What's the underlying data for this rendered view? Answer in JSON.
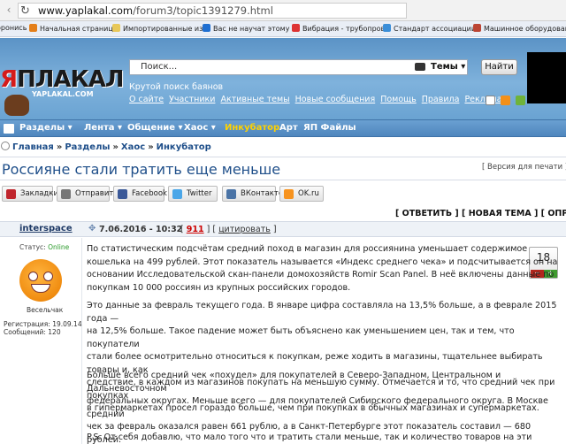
{
  "browser": {
    "url_host": "www.yaplakal.com",
    "url_path": "/forum3/topic1391279.html",
    "bookmarks": [
      {
        "label": "оронись",
        "color": "#c33"
      },
      {
        "label": "Начальная страница",
        "color": "#e47f1a"
      },
      {
        "label": "Импортированные из F",
        "color": "#e8c85a"
      },
      {
        "label": "Вас не научат этому в",
        "color": "#1f6fd1"
      },
      {
        "label": "Вибрация - трубопров",
        "color": "#d33"
      },
      {
        "label": "Стандарт ассоциации",
        "color": "#3a8ed8"
      },
      {
        "label": "Машинное оборудован",
        "color": "#b43"
      }
    ]
  },
  "site": {
    "logo_text": "ЯПЛАКАЛ",
    "logo_domain": "YAPLAKAL.COM",
    "search_placeholder": "Поиск...",
    "search_scope": "Темы ▾",
    "find_button": "Найти",
    "tagline": "Крутой поиск баянов",
    "header_links": [
      "О сайте",
      "Участники",
      "Активные темы",
      "Новые сообщения",
      "Помощь",
      "Правила",
      "Реклама"
    ]
  },
  "menu": {
    "items": [
      {
        "label": "Разделы ▾"
      },
      {
        "label": "Лента ▾"
      },
      {
        "label": "Общение ▾"
      },
      {
        "label": "Хаос ▾"
      },
      {
        "label": "Инкубатор"
      },
      {
        "label": "Арт"
      },
      {
        "label": "ЯП Файлы"
      }
    ],
    "active": "Инкубатор"
  },
  "breadcrumbs": [
    "Главная",
    "Разделы",
    "Хаос",
    "Инкубатор"
  ],
  "topic": {
    "title": "Россияне стали тратить еще меньше",
    "print_version": "[ Версия для печати ]",
    "share": [
      {
        "label": "Закладки",
        "color": "#c0262d"
      },
      {
        "label": "Отправить",
        "color": "#777"
      },
      {
        "label": "Facebook",
        "color": "#3b5998"
      },
      {
        "label": "Twitter",
        "color": "#4aa6e8"
      },
      {
        "label": "ВКонтакте",
        "color": "#4b74a6"
      },
      {
        "label": "OK.ru",
        "color": "#f7931e"
      }
    ],
    "actions": "[ ОТВЕТИТЬ ] [ НОВАЯ ТЕМА ] [ ОПРОС ]"
  },
  "post": {
    "author": "interspace",
    "date": "7.06.2016 - 10:32",
    "number_prefix": "[",
    "number": "911",
    "number_suffix": "] [",
    "quote": "цитировать",
    "number_end": "]",
    "status_label": "Статус:",
    "status_value": "Online",
    "rank": "Весельчак",
    "registered": "Регистрация: 19.09.14",
    "messages": "Сообщений: 120",
    "rating": "18",
    "rating_minus": "−",
    "rating_plus": "+",
    "paragraphs": [
      [
        "По статистическим подсчётам средний поход в магазин для россиянина уменьшает содержимое",
        "кошелька на 499 рублей. Этот показатель называется «Индекс среднего чека» и подсчитывается он на",
        "основании Исследовательской скан-панели домохозяйств Romir Scan Panel. В неё включены данные по",
        "покупкам 10 000 россиян из крупных российских городов."
      ],
      [
        "Это данные за февраль текущего года. В январе цифра составляла на 13,5% больше, а в феврале 2015 года —",
        "на 12,5% больше. Такое падение может быть объяснено как уменьшением цен, так и тем, что покупатели",
        "стали более осмотрительно относиться к покупкам, реже ходить в магазины, тщательнее выбирать товары и, как",
        "следствие, в каждом из магазинов покупать на меньшую сумму. Отмечается и то, что средний чек при покупках",
        "в гипермаркетах просел гораздо больше, чем при покупках в обычных магазинах и супермаркетах."
      ],
      [
        "Больше всего средний чек «похудел» для покупателей в Северо-Западном, Центральном и Дальневосточном",
        "федеральных округах. Меньше всего — для покупателей Сибирского федерального округа. В Москве средний",
        "чек за февраль оказался равен 661 рублю, а в Санкт-Петербурге этот показатель составил — 680 рублей."
      ],
      [
        "P.S. От себя добавлю, что мало того что и тратить стали меньше, так и количество товаров на эти деньги"
      ]
    ]
  }
}
